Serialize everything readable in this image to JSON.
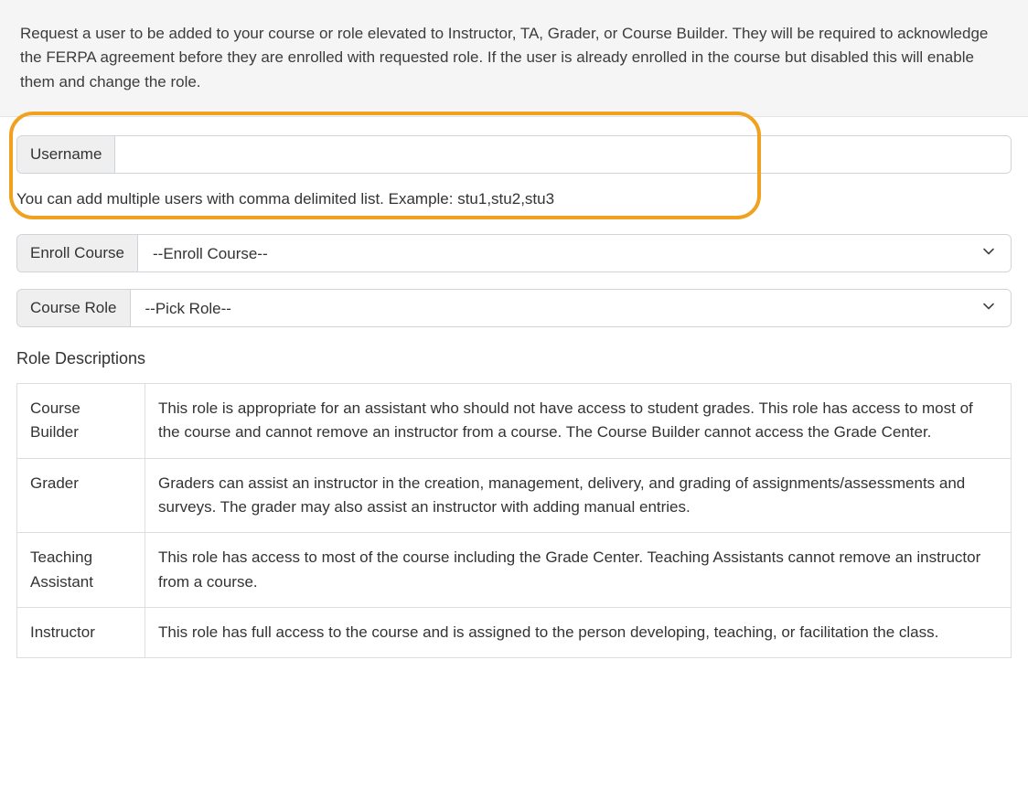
{
  "header": {
    "description": "Request a user to be added to your course or role elevated to Instructor, TA, Grader, or Course Builder. They will be required to acknowledge the FERPA agreement before they are enrolled with requested role. If the user is already enrolled in the course but disabled this will enable them and change the role."
  },
  "form": {
    "username": {
      "label": "Username",
      "value": "",
      "help": "You can add multiple users with comma delimited list. Example: stu1,stu2,stu3"
    },
    "enroll_course": {
      "label": "Enroll Course",
      "selected": "--Enroll Course--"
    },
    "course_role": {
      "label": "Course Role",
      "selected": "--Pick Role--"
    }
  },
  "roles": {
    "heading": "Role Descriptions",
    "items": [
      {
        "name": "Course Builder",
        "desc": "This role is appropriate for an assistant who should not have access to student grades. This role has access to most of the course and cannot remove an instructor from a course. The Course Builder cannot access the Grade Center."
      },
      {
        "name": "Grader",
        "desc": "Graders can assist an instructor in the creation, management, delivery, and grading of assignments/assessments and surveys. The grader may also assist an instructor with adding manual entries."
      },
      {
        "name": "Teaching Assistant",
        "desc": "This role has access to most of the course including the Grade Center. Teaching Assistants cannot remove an instructor from a course."
      },
      {
        "name": "Instructor",
        "desc": "This role has full access to the course and is assigned to the person developing, teaching, or facilitation the class."
      }
    ]
  }
}
